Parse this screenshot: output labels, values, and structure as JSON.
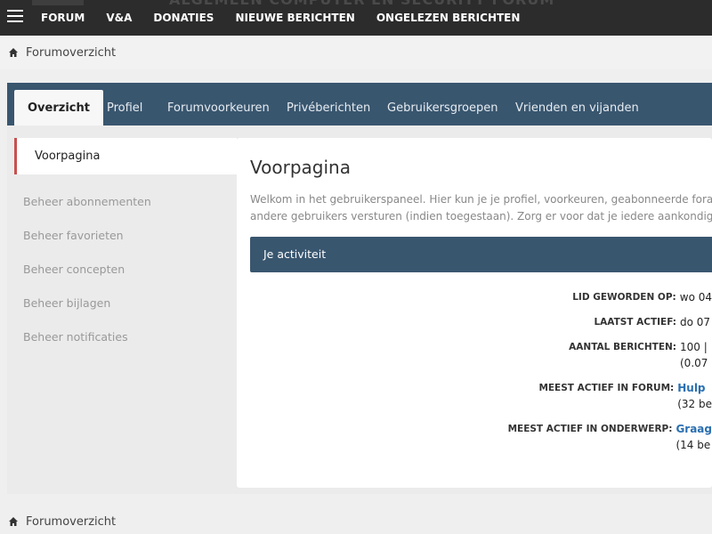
{
  "topbar": {
    "banner": "ALGEMEEN COMPUTER EN SECURITY FORUM",
    "nav": [
      "FORUM",
      "V&A",
      "DONATIES",
      "NIEUWE BERICHTEN",
      "ONGELEZEN BERICHTEN"
    ]
  },
  "breadcrumb": {
    "label": "Forumoverzicht"
  },
  "tabs": [
    "Overzicht",
    "Profiel",
    "Forumvoorkeuren",
    "Privéberichten",
    "Gebruikersgroepen",
    "Vrienden en vijanden"
  ],
  "sidebar": {
    "active": "Voorpagina",
    "items": [
      "Beheer abonnementen",
      "Beheer favorieten",
      "Beheer concepten",
      "Beheer bijlagen",
      "Beheer notificaties"
    ]
  },
  "content": {
    "title": "Voorpagina",
    "intro_line1": "Welkom in het gebruikerspaneel. Hier kun je je profiel, voorkeuren, geabonneerde fora en",
    "intro_line2": "andere gebruikers versturen (indien toegestaan). Zorg er voor dat je iedere aankondiging",
    "activity_header": "Je activiteit",
    "stats": {
      "joined_label": "Lid geworden op:",
      "joined_value": "wo 04",
      "last_active_label": "Laatst actief:",
      "last_active_value": "do 07",
      "posts_label": "Aantal berichten:",
      "posts_value": "100 |",
      "posts_sub": "(0.07",
      "forum_label": "Meest actief in forum:",
      "forum_value": "Hulp",
      "forum_sub": "(32 be",
      "topic_label": "Meest actief in onderwerp:",
      "topic_value": "Graag",
      "topic_sub": "(14 be"
    }
  },
  "colors": {
    "navy": "#39566f",
    "accent": "#c85050",
    "link": "#2a6fb0",
    "topbar": "#2c2c2c"
  },
  "icons": {
    "menu": "hamburger-icon",
    "home": "home-icon"
  }
}
